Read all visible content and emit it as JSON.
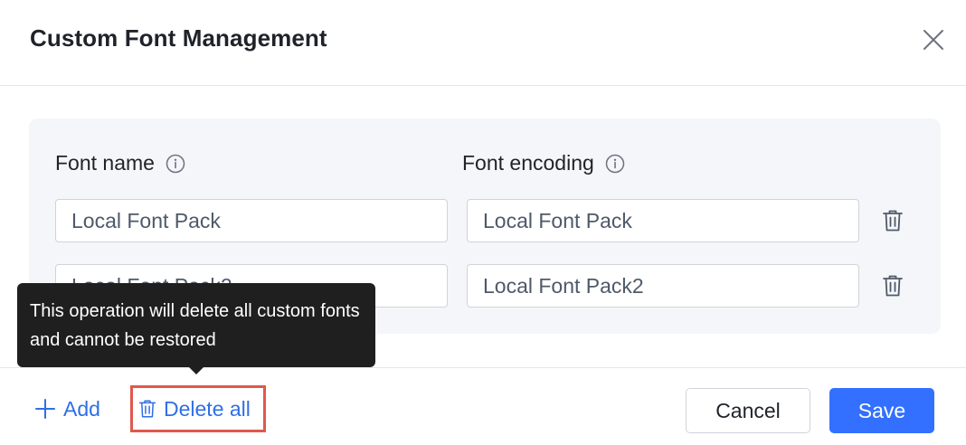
{
  "dialog": {
    "title": "Custom Font Management",
    "close_icon": "close-icon"
  },
  "columns": {
    "font_name": {
      "label": "Font name",
      "icon": "info-icon"
    },
    "font_encoding": {
      "label": "Font encoding",
      "icon": "info-icon"
    }
  },
  "rows": [
    {
      "font_name": "Local Font Pack",
      "font_encoding": "Local Font Pack",
      "delete_icon": "trash-icon"
    },
    {
      "font_name": "Local Font Pack2",
      "font_encoding": "Local Font Pack2",
      "delete_icon": "trash-icon"
    }
  ],
  "tooltip": {
    "text": "This operation will delete all custom fonts and cannot be restored"
  },
  "footer": {
    "add_label": "Add",
    "add_icon": "plus-icon",
    "delete_all_label": "Delete all",
    "delete_all_icon": "trash-icon",
    "cancel_label": "Cancel",
    "save_label": "Save"
  },
  "colors": {
    "accent": "#3370ff",
    "link": "#2f6fe6",
    "highlight_border": "#e2574c",
    "tooltip_bg": "#1f1f1f",
    "panel_bg": "#f5f6fa"
  }
}
